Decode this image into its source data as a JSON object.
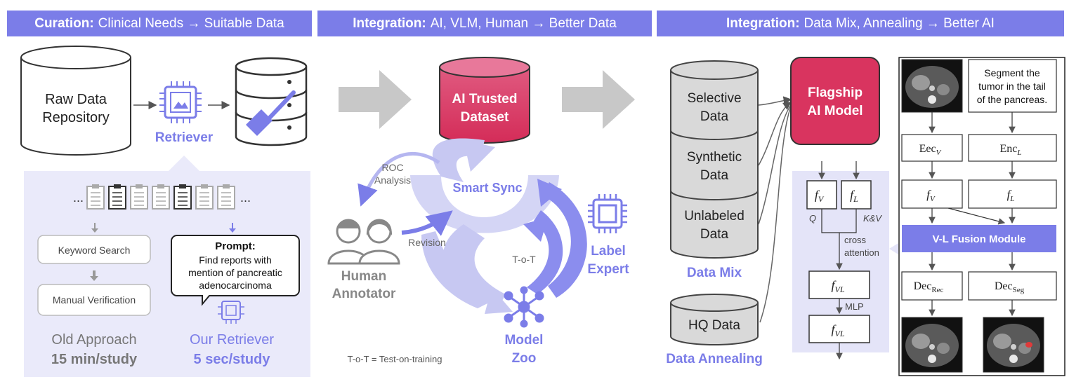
{
  "headers": [
    {
      "bold": "Curation:",
      "rest": "Clinical Needs → Suitable Data"
    },
    {
      "bold": "Integration:",
      "rest": "AI, VLM, Human → Better Data"
    },
    {
      "bold": "Integration:",
      "rest": "Data Mix, Annealing → Better AI"
    }
  ],
  "curation": {
    "raw_data": [
      "Raw Data",
      "Repository"
    ],
    "retriever": "Retriever",
    "dots": "...",
    "keyword_search": "Keyword Search",
    "manual_verification": "Manual Verification",
    "prompt_title": "Prompt:",
    "prompt_lines": [
      "Find reports with",
      "mention of pancreatic",
      "adenocarcinoma"
    ],
    "old_approach": "Old Approach",
    "old_time": "15 min/study",
    "our_retriever": "Our Retriever",
    "our_time": "5 sec/study"
  },
  "integration": {
    "trusted_dataset": [
      "AI Trusted",
      "Dataset"
    ],
    "roc": [
      "ROC",
      "Analysis"
    ],
    "smart_sync": "Smart Sync",
    "revision": "Revision",
    "human_annotator": [
      "Human",
      "Annotator"
    ],
    "tot": "T-o-T",
    "label_expert": [
      "Label",
      "Expert"
    ],
    "model_zoo": [
      "Model",
      "Zoo"
    ],
    "footnote": "T-o-T = Test-on-training"
  },
  "model": {
    "selective": [
      "Selective",
      "Data"
    ],
    "synthetic": [
      "Synthetic",
      "Data"
    ],
    "unlabeled": [
      "Unlabeled",
      "Data"
    ],
    "data_mix": "Data Mix",
    "hq": "HQ Data",
    "data_annealing": "Data Annealing",
    "flagship": [
      "Flagship",
      "AI Model"
    ],
    "fv": "f",
    "fv_sub": "V",
    "fl": "f",
    "fl_sub": "L",
    "fvl_sub": "VL",
    "q": "Q",
    "kv": "K&V",
    "cross_attention": [
      "cross",
      "attention"
    ],
    "mlp": "MLP",
    "segment_text": [
      "Segment the",
      "tumor in the tail",
      "of the pancreas."
    ],
    "enc_v": "Eec",
    "enc_v_sub": "V",
    "enc_l": "Enc",
    "enc_l_sub": "L",
    "fusion": "V-L Fusion Module",
    "dec_rec": "Dec",
    "dec_rec_sub": "Rec",
    "dec_seg": "Dec",
    "dec_seg_sub": "Seg"
  },
  "colors": {
    "accent": "#7b7de8",
    "dataset": "#d9345f",
    "grey": "#d9d9d9"
  }
}
